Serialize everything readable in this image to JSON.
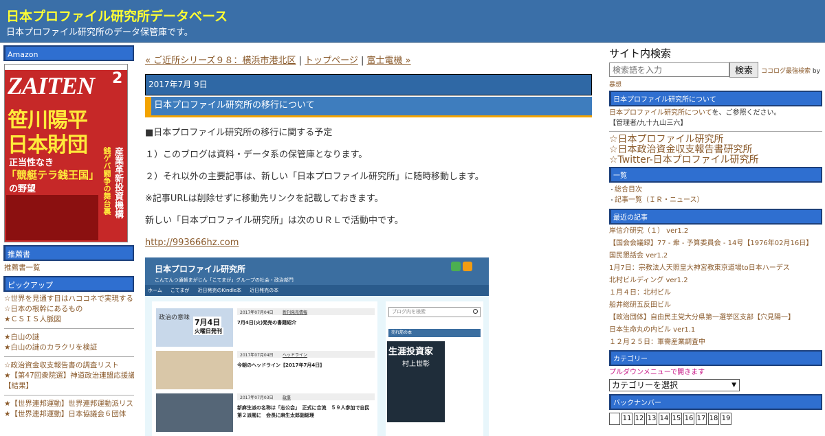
{
  "header": {
    "title": "日本プロファイル研究所データベース",
    "description": "日本プロファイル研究所のデータ保管庫です。"
  },
  "left": {
    "amazon_head": "Amazon",
    "magazine": {
      "logo": "ZAITEN",
      "issue": "2",
      "headline1": "笹川陽平",
      "headline2": "日本財団",
      "sub1": "正当性なき",
      "sub2": "「競艇テラ銭王国」",
      "sub3": "の野望",
      "side": "産業革新投資機構",
      "side2": "銭ゲバ闘争の舞台裏"
    },
    "recommend_head": "推薦書",
    "recommend_items": [
      "推薦書一覧"
    ],
    "pickup_head": "ピックアップ",
    "pickup_groups": [
      [
        "☆世界を見通す目はハココネで実現する（1）",
        "☆日本の根幹にあるもの",
        "★ＣＳＩＳ人脈図"
      ],
      [
        "★白山の謎",
        "★白山の謎のカラクリを検証"
      ],
      [
        "☆政治資金収支報告書の調査リスト",
        "★【第47回衆院選】神道政治連盟応援議員",
        "【結果】"
      ],
      [
        "★【世界連邦運動】世界連邦運動派リスト",
        "★【世界連邦運動】日本協議会６団体"
      ]
    ]
  },
  "center": {
    "nav_prev": "« ご近所シリーズ９８：横浜市港北区",
    "nav_sep1": "|",
    "nav_top": "トップページ",
    "nav_sep2": "|",
    "nav_next": "富士電機 »",
    "date": "2017年7月 9日",
    "post_title": "日本プロファイル研究所の移行について",
    "paragraphs": [
      "■日本プロファイル研究所の移行に関する予定",
      "１）このブログは資料・データ系の保管庫となります。",
      "２）それ以外の主要記事は、新しい「日本プロファイル研究所」に随時移動します。",
      "※記事URLは削除せずに移動先リンクを記載しておきます。",
      "新しい「日本プロファイル研究所」は次のＵＲＬで活動中です。"
    ],
    "link": "http://993666hz.com",
    "screenshot": {
      "site_title": "日本プロファイル研究所",
      "site_sub": "こんてんつ通帳まがじん「こてまが」グループの社会・政治部門",
      "nav": [
        "ホーム",
        "こてまが",
        "近日発売のKindle本",
        "近日発売の本"
      ],
      "search_placeholder": "ブログ内を検索",
      "sold_head": "売れ筋の本",
      "book_title": "生涯投資家",
      "book_author": "村上世彰",
      "posts": [
        {
          "date": "2017年07月04日",
          "cat": "新刊発売情報",
          "title": "7月4日(火)発売の書籍紹介",
          "thumb_big": "7月4日",
          "thumb_small": "火曜日発刊",
          "thumb_label": "政治の意味"
        },
        {
          "date": "2017年07月04日",
          "cat": "ヘッドライン",
          "title": "今朝のヘッドライン【2017年7月4日】"
        },
        {
          "date": "2017年07月03日",
          "cat": "政事",
          "title": "新麻生派の名称は「志公会」　正式に合流　５９人参加で自民第２派閥に　会長に麻生太郎副総理"
        }
      ]
    }
  },
  "right": {
    "search_title": "サイト内検索",
    "search_placeholder": "検索語を入力",
    "search_button": "検索",
    "search_credit_link": "ココログ最強検索",
    "search_credit_by": " by",
    "search_credit_author": "暴想",
    "about_head": "日本プロファイル研究所について",
    "about_link": "日本プロファイル研究所について",
    "about_text": "を、ご参照ください。",
    "about_admin": "【管理者/九十九山三六】",
    "big_links": [
      "☆日本プロファイル研究所",
      "☆日本政治資金収支報告書研究所",
      "☆Twitter-日本プロファイル研究所"
    ],
    "list_head": "一覧",
    "list_items": [
      "総合目次",
      "記事一覧（ＩＲ・ニュース）"
    ],
    "recent_head": "最近の記事",
    "recent_items": [
      "岸信介研究（１） ver1.2",
      "【国会会議録】77 - 衆 - 予算委員会 - 14号【1976年02月16日】",
      "国民懇話会 ver1.2",
      "1月7日：宗教法人天照皇大神宮教東京道場to日本ハーデス",
      "北村ビルディング ver1.2",
      "１月４日：北村ビル",
      "船井総研五反田ビル",
      "【政治団体】自由民主党大分県第一選挙区支部【穴見陽一】",
      "日本生命丸の内ビル ver1.1",
      "１２月２５日：軍需産業調査中"
    ],
    "category_head": "カテゴリー",
    "category_note": "プルダウンメニューで開きます",
    "category_select": "カテゴリーを選択",
    "backnumber_head": "バックナンバー",
    "backnumbers": [
      "",
      "11",
      "12",
      "13",
      "14",
      "15",
      "16",
      "17",
      "18",
      "19"
    ],
    "colors": {
      "header": "#3a6fa8",
      "title": "#ffff33",
      "sidehead": "#2f6fd0",
      "link": "#8a5a2b",
      "accent": "#f3a300"
    }
  }
}
